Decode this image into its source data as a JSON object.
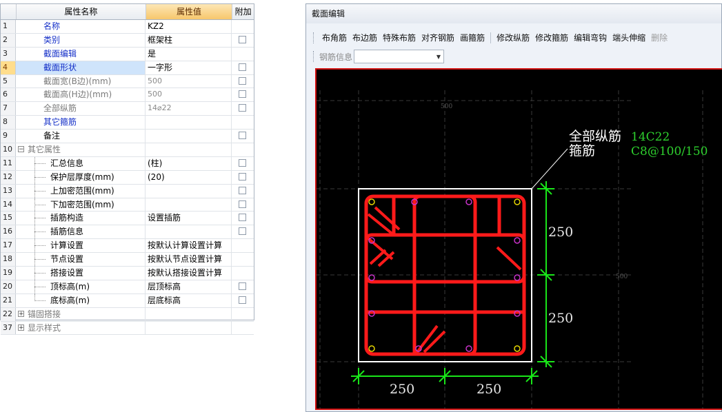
{
  "property_grid": {
    "headers": {
      "name": "属性名称",
      "value": "属性值",
      "extra": "附加"
    },
    "rows": [
      {
        "num": "1",
        "name": "名称",
        "value": "KZ2",
        "style": "blue",
        "checkbox": false
      },
      {
        "num": "2",
        "name": "类别",
        "value": "框架柱",
        "style": "blue",
        "checkbox": true
      },
      {
        "num": "3",
        "name": "截面编辑",
        "value": "是",
        "style": "blue",
        "checkbox": false
      },
      {
        "num": "4",
        "name": "截面形状",
        "value": "一字形",
        "style": "blue",
        "checkbox": true,
        "selected": true
      },
      {
        "num": "5",
        "name": "截面宽(B边)(mm)",
        "value": "500",
        "style": "gray",
        "checkbox": true
      },
      {
        "num": "6",
        "name": "截面高(H边)(mm)",
        "value": "500",
        "style": "gray",
        "checkbox": true
      },
      {
        "num": "7",
        "name": "全部纵筋",
        "value": "14⌀22",
        "style": "gray",
        "checkbox": true
      },
      {
        "num": "8",
        "name": "其它箍筋",
        "value": "",
        "style": "blue",
        "checkbox": false
      },
      {
        "num": "9",
        "name": "备注",
        "value": "",
        "style": "black",
        "checkbox": true
      },
      {
        "num": "10",
        "name": "其它属性",
        "value": "",
        "style": "group",
        "expander": "−",
        "checkbox": false
      },
      {
        "num": "11",
        "name": "汇总信息",
        "value": "(柱)",
        "style": "child",
        "checkbox": true
      },
      {
        "num": "12",
        "name": "保护层厚度(mm)",
        "value": "(20)",
        "style": "child",
        "checkbox": true
      },
      {
        "num": "13",
        "name": "上加密范围(mm)",
        "value": "",
        "style": "child",
        "checkbox": true
      },
      {
        "num": "14",
        "name": "下加密范围(mm)",
        "value": "",
        "style": "child",
        "checkbox": true
      },
      {
        "num": "15",
        "name": "插筋构造",
        "value": "设置插筋",
        "style": "child",
        "checkbox": true
      },
      {
        "num": "16",
        "name": "插筋信息",
        "value": "",
        "style": "child",
        "checkbox": true
      },
      {
        "num": "17",
        "name": "计算设置",
        "value": "按默认计算设置计算",
        "style": "child",
        "checkbox": false
      },
      {
        "num": "18",
        "name": "节点设置",
        "value": "按默认节点设置计算",
        "style": "child",
        "checkbox": false
      },
      {
        "num": "19",
        "name": "搭接设置",
        "value": "按默认搭接设置计算",
        "style": "child",
        "checkbox": false
      },
      {
        "num": "20",
        "name": "顶标高(m)",
        "value": "层顶标高",
        "style": "child",
        "checkbox": true
      },
      {
        "num": "21",
        "name": "底标高(m)",
        "value": "层底标高",
        "style": "child-last",
        "checkbox": true
      },
      {
        "num": "22",
        "name": "锚固搭接",
        "value": "",
        "style": "group",
        "expander": "+",
        "checkbox": false
      },
      {
        "num": "37",
        "name": "显示样式",
        "value": "",
        "style": "group",
        "expander": "+",
        "checkbox": false
      }
    ]
  },
  "section_editor": {
    "title": "截面编辑",
    "toolbar": [
      "布角筋",
      "布边筋",
      "特殊布筋",
      "对齐钢筋",
      "画箍筋",
      "修改纵筋",
      "修改箍筋",
      "编辑弯钩",
      "端头伸缩"
    ],
    "toolbar_disabled": "删除",
    "rebar_info_label": "钢筋信息",
    "rebar_info_value": ""
  },
  "drawing": {
    "all_rebar_label": "全部纵筋",
    "all_rebar_value": "14C22",
    "stirrup_label": "箍筋",
    "stirrup_value": "C8@100/150",
    "dim_vertical": [
      "250",
      "250"
    ],
    "dim_horizontal": [
      "250",
      "250"
    ],
    "grid_label_top": "500",
    "grid_label_right": "500",
    "colors": {
      "rebar": "#ff1a1a",
      "dimension": "#19e619",
      "annotation_value": "#2ed12e",
      "outline": "#ffffff",
      "bar_dot": "#c832c8",
      "corner_bar": "#e6d600"
    }
  }
}
